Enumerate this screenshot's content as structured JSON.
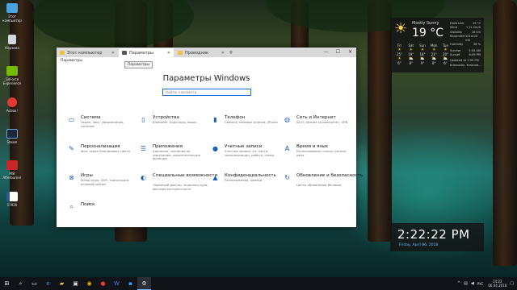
{
  "desktop": {
    "icons": [
      {
        "label": "Этот компьютер",
        "icon": "computer-icon",
        "color": "#4aa3df"
      },
      {
        "label": "Корзина",
        "icon": "recycle-bin-icon",
        "color": "#cfd8dc"
      },
      {
        "label": "GeForce Experience",
        "icon": "geforce-icon",
        "color": "#76b900"
      },
      {
        "label": "Action!",
        "icon": "action-icon",
        "color": "#e53935"
      },
      {
        "label": "Steam",
        "icon": "steam-icon",
        "color": "#1b2838"
      },
      {
        "label": "MSI Afterburner",
        "icon": "afterburner-icon",
        "color": "#c62828"
      },
      {
        "label": "17920",
        "icon": "word-doc-icon",
        "color": "#2b579a"
      }
    ]
  },
  "window": {
    "tabs": [
      {
        "label": "Этот компьютер",
        "icon": "folder-icon"
      },
      {
        "label": "Параметры",
        "icon": "settings-icon"
      },
      {
        "label": "Проводник",
        "icon": "folder-icon"
      }
    ],
    "new_tab": "+",
    "controls": {
      "minimize": "—",
      "maximize": "☐",
      "close": "✕"
    },
    "subtitle": "Параметры",
    "tooltip": "Параметры",
    "title": "Параметры Windows",
    "search_placeholder": "Найти параметр"
  },
  "settings": [
    {
      "title": "Система",
      "desc": "Экран, звук, уведомления, питание",
      "icon": "laptop-icon"
    },
    {
      "title": "Устройства",
      "desc": "Bluetooth, принтеры, мышь",
      "icon": "devices-icon"
    },
    {
      "title": "Телефон",
      "desc": "Связать телефон Android, iPhone",
      "icon": "phone-icon"
    },
    {
      "title": "Сеть и Интернет",
      "desc": "Wi-Fi, режим «в самолете», VPN",
      "icon": "globe-icon"
    },
    {
      "title": "Персонализация",
      "desc": "Фон, экран блокировки, цвета",
      "icon": "personalization-icon"
    },
    {
      "title": "Приложения",
      "desc": "Удаление, значения по умолчанию, дополнительные функции",
      "icon": "apps-icon"
    },
    {
      "title": "Учетные записи",
      "desc": "Учетные записи, эл. почта, синхронизация, работа, семья",
      "icon": "account-icon"
    },
    {
      "title": "Время и язык",
      "desc": "Распознавание голоса, регион, дата",
      "icon": "time-language-icon"
    },
    {
      "title": "Игры",
      "desc": "Меню игры, DVR, трансляция, игровой режим",
      "icon": "xbox-icon"
    },
    {
      "title": "Специальные возможности",
      "desc": "Экранный диктор, экранная лупа, высокая контрастность",
      "icon": "accessibility-icon"
    },
    {
      "title": "Конфиденциальность",
      "desc": "Расположение, камера",
      "icon": "lock-icon"
    },
    {
      "title": "Обновление и безопасность",
      "desc": "Центр обновления Windows",
      "icon": "update-icon"
    },
    {
      "title": "Поиск",
      "desc": "",
      "icon": "search-icon"
    }
  ],
  "weather": {
    "condition": "Mostly Sunny",
    "temp": "19 °C",
    "details": [
      {
        "k": "Feels Like",
        "v": "19 °C"
      },
      {
        "k": "Wind",
        "v": "→ 21 km/h"
      },
      {
        "k": "Visibility",
        "v": "16 km"
      },
      {
        "k": "Barometer",
        "v": "1014.00 mb"
      },
      {
        "k": "Humidity",
        "v": "38 %"
      },
      {
        "k": "Sunrise",
        "v": "5:55 AM"
      },
      {
        "k": "Sunset",
        "v": "6:59 PM"
      }
    ],
    "days": [
      {
        "name": "Fri",
        "hi": "25°",
        "lo": "6°"
      },
      {
        "name": "Sat",
        "hi": "19°",
        "lo": "8°"
      },
      {
        "name": "Sun",
        "hi": "18°",
        "lo": "9°"
      },
      {
        "name": "Mon",
        "hi": "21°",
        "lo": "8°"
      },
      {
        "name": "Tue",
        "hi": "20°",
        "lo": "6°"
      }
    ],
    "updated": "Updated at 1:59 PM",
    "location": "Krasnodar, Krasnod..."
  },
  "clock": {
    "time": "2:22:22 PM",
    "date": "Friday, April 06, 2018"
  },
  "taskbar": {
    "items": [
      {
        "icon": "start-icon",
        "glyph": "⊞"
      },
      {
        "icon": "search-icon",
        "glyph": "⌕"
      },
      {
        "icon": "task-view-icon",
        "glyph": "▭"
      },
      {
        "icon": "edge-icon",
        "glyph": "e"
      },
      {
        "icon": "explorer-icon",
        "glyph": "▰"
      },
      {
        "icon": "store-icon",
        "glyph": "▣"
      },
      {
        "icon": "chrome-icon",
        "glyph": "◉"
      },
      {
        "icon": "action-icon",
        "glyph": "●"
      },
      {
        "icon": "word-icon",
        "glyph": "W"
      },
      {
        "icon": "photoshop-icon",
        "glyph": "▪"
      },
      {
        "icon": "settings-icon",
        "glyph": "⚙"
      }
    ],
    "tray": {
      "lang": "РУС",
      "time": "14:22",
      "date": "06.04.2018"
    }
  }
}
